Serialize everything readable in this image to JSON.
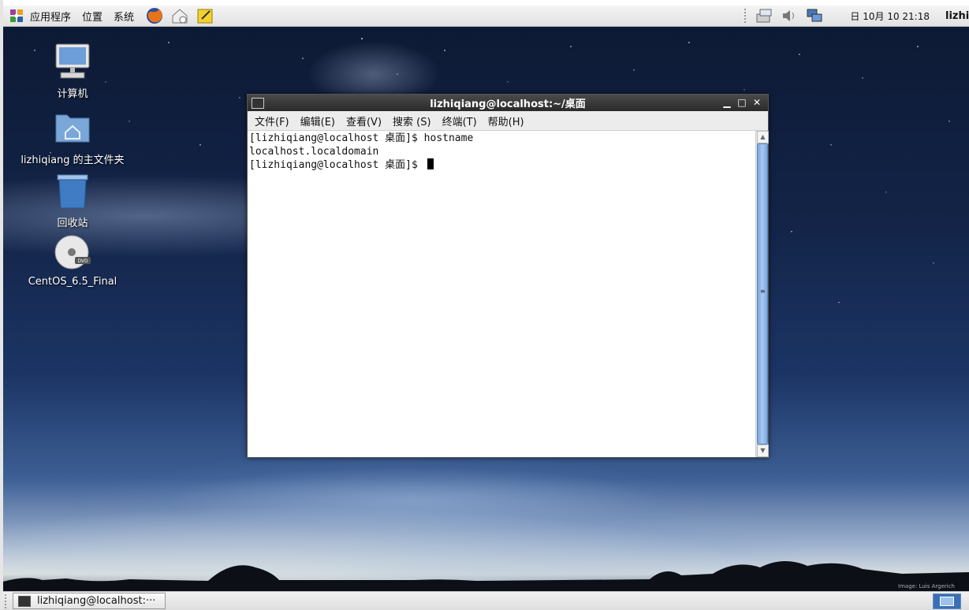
{
  "top_panel": {
    "menu": [
      "应用程序",
      "位置",
      "系统"
    ],
    "launchers": [
      "firefox-icon",
      "mail-icon",
      "notes-icon"
    ],
    "tray_icons": [
      "network-icon",
      "volume-icon",
      "display-icon"
    ],
    "clock": "日 10月 10 21:18",
    "user": "lizhiqiang"
  },
  "desktop": {
    "icons": [
      {
        "name": "computer",
        "label": "计算机",
        "icon": "computer-icon"
      },
      {
        "name": "home-folder",
        "label": "lizhiqiang 的主文件夹",
        "icon": "home-folder-icon"
      },
      {
        "name": "trash",
        "label": "回收站",
        "icon": "trash-icon"
      },
      {
        "name": "dvd",
        "label": "CentOS_6.5_Final",
        "icon": "dvd-icon"
      }
    ],
    "credit": "Image: Luis Argerich"
  },
  "terminal": {
    "title": "lizhiqiang@localhost:~/桌面",
    "menu": [
      "文件(F)",
      "编辑(E)",
      "查看(V)",
      "搜索 (S)",
      "终端(T)",
      "帮助(H)"
    ],
    "lines": [
      "[lizhiqiang@localhost 桌面]$ hostname",
      "localhost.localdomain",
      "[lizhiqiang@localhost 桌面]$ "
    ]
  },
  "bottom_panel": {
    "task_label": "lizhiqiang@localhost:···"
  },
  "colors": {
    "panel": "#e6e6e6",
    "titlebar": "#2f2f2f",
    "scroll_thumb": "#8fb5e6"
  }
}
